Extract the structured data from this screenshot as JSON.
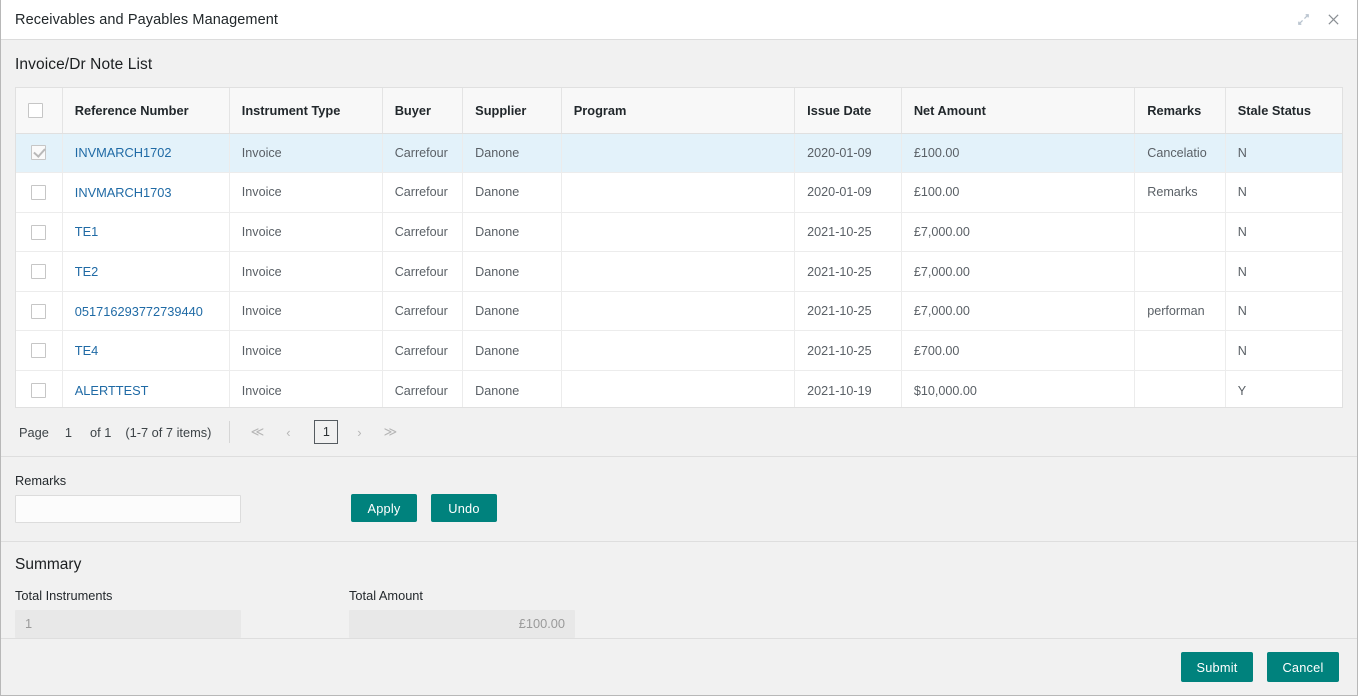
{
  "window": {
    "title": "Receivables and Payables Management",
    "actions": [
      {
        "name": "minimize-icon",
        "label": "Minimize"
      },
      {
        "name": "close-icon",
        "label": "Close"
      }
    ]
  },
  "list": {
    "heading": "Invoice/Dr Note List",
    "columns": [
      "Reference Number",
      "Instrument Type",
      "Buyer",
      "Supplier",
      "Program",
      "Issue Date",
      "Net Amount",
      "Remarks",
      "Stale Status"
    ],
    "rows": [
      {
        "selected": true,
        "reference": "INVMARCH1702",
        "instrument_type": "Invoice",
        "buyer": "Carrefour",
        "supplier": "Danone",
        "program": "",
        "issue_date": "2020-01-09",
        "net_amount": "£100.00",
        "remarks": "Cancelatio",
        "stale_status": "N"
      },
      {
        "selected": false,
        "reference": "INVMARCH1703",
        "instrument_type": "Invoice",
        "buyer": "Carrefour",
        "supplier": "Danone",
        "program": "",
        "issue_date": "2020-01-09",
        "net_amount": "£100.00",
        "remarks": "Remarks",
        "stale_status": "N"
      },
      {
        "selected": false,
        "reference": "TE1",
        "instrument_type": "Invoice",
        "buyer": "Carrefour",
        "supplier": "Danone",
        "program": "",
        "issue_date": "2021-10-25",
        "net_amount": "£7,000.00",
        "remarks": "",
        "stale_status": "N"
      },
      {
        "selected": false,
        "reference": "TE2",
        "instrument_type": "Invoice",
        "buyer": "Carrefour",
        "supplier": "Danone",
        "program": "",
        "issue_date": "2021-10-25",
        "net_amount": "£7,000.00",
        "remarks": "",
        "stale_status": "N"
      },
      {
        "selected": false,
        "reference": "051716293772739440",
        "instrument_type": "Invoice",
        "buyer": "Carrefour",
        "supplier": "Danone",
        "program": "",
        "issue_date": "2021-10-25",
        "net_amount": "£7,000.00",
        "remarks": "performan",
        "stale_status": "N"
      },
      {
        "selected": false,
        "reference": "TE4",
        "instrument_type": "Invoice",
        "buyer": "Carrefour",
        "supplier": "Danone",
        "program": "",
        "issue_date": "2021-10-25",
        "net_amount": "£700.00",
        "remarks": "",
        "stale_status": "N"
      },
      {
        "selected": false,
        "reference": "ALERTTEST",
        "instrument_type": "Invoice",
        "buyer": "Carrefour",
        "supplier": "Danone",
        "program": "",
        "issue_date": "2021-10-19",
        "net_amount": "$10,000.00",
        "remarks": "",
        "stale_status": "Y"
      }
    ]
  },
  "pagination": {
    "page_label": "Page",
    "page_number": "1",
    "of_label": "of 1",
    "items_label": "(1-7 of 7 items)",
    "first_icon": "≪",
    "prev_icon": "‹",
    "current_page": "1",
    "next_icon": "›",
    "last_icon": "≫"
  },
  "remarks_section": {
    "label": "Remarks",
    "value": "",
    "placeholder": "",
    "apply_label": "Apply",
    "undo_label": "Undo"
  },
  "summary": {
    "title": "Summary",
    "total_instruments_label": "Total Instruments",
    "total_instruments_value": "1",
    "total_amount_label": "Total Amount",
    "total_amount_value": "£100.00"
  },
  "footer": {
    "submit_label": "Submit",
    "cancel_label": "Cancel"
  },
  "colors": {
    "accent_teal": "#00827d",
    "link_blue": "#1f6aa5",
    "selected_row": "#e3f2fa"
  }
}
